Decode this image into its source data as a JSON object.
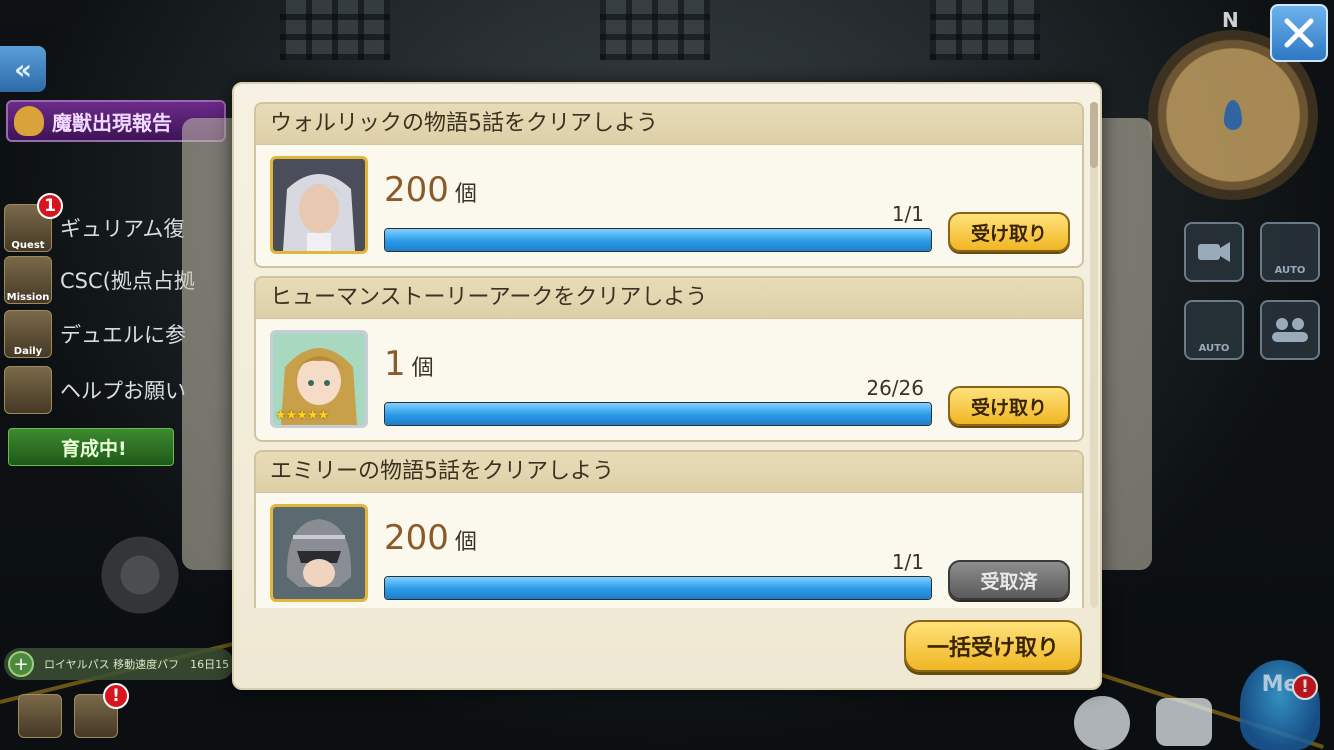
{
  "left_menu": {
    "back_label": "«",
    "monster_report": "魔獣出現報告",
    "items": [
      {
        "label": "ギュリアム復",
        "icon_text": "Quest",
        "badge": "1"
      },
      {
        "label": "CSC(拠点占拠",
        "icon_text": "Mission",
        "badge": ""
      },
      {
        "label": "デュエルに参",
        "icon_text": "Daily",
        "badge": ""
      },
      {
        "label": "ヘルプお願い",
        "icon_text": "",
        "badge": ""
      }
    ],
    "growing": "育成中!",
    "royal_pass": "ロイヤルパス 移動速度バフ　16日15",
    "bottom_badge": "!"
  },
  "hud": {
    "north": "N",
    "auto_label": "AUTO",
    "auto_label_2": "AUTO",
    "me_label": "Me",
    "me_badge": "!"
  },
  "dialog": {
    "missions": [
      {
        "title": "ウォルリックの物語5話をクリアしよう",
        "reward_amount": "200",
        "reward_unit": "個",
        "progress_text": "1/1",
        "progress": 1.0,
        "button": "受け取り",
        "claimed": false,
        "portrait": "silver-haired-man"
      },
      {
        "title": "ヒューマンストーリーアークをクリアしよう",
        "reward_amount": "1",
        "reward_unit": "個",
        "progress_text": "26/26",
        "progress": 1.0,
        "button": "受け取り",
        "claimed": false,
        "portrait": "blonde-girl",
        "stars": "★★★★★"
      },
      {
        "title": "エミリーの物語5話をクリアしよう",
        "reward_amount": "200",
        "reward_unit": "個",
        "progress_text": "1/1",
        "progress": 1.0,
        "button": "受取済",
        "claimed": true,
        "portrait": "armored-helmet-girl"
      }
    ],
    "claim_all": "一括受け取り"
  },
  "colors": {
    "accent_gold": "#f0b624",
    "progress_blue": "#2a9ae8",
    "dialog_bg": "#f6f1e2"
  }
}
